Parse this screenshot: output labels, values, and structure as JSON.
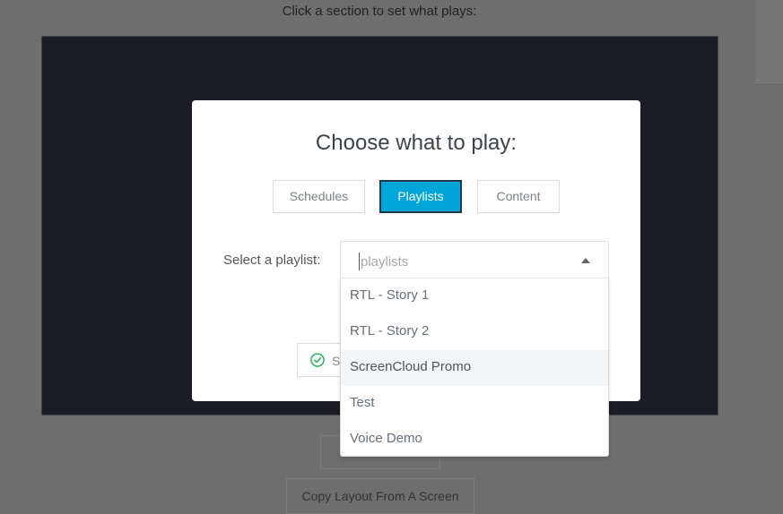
{
  "background": {
    "hint": "Click a section to set what plays:",
    "button_1_label": "",
    "button_2_label": "Copy Layout From A Screen"
  },
  "modal": {
    "title": "Choose what to play:",
    "tabs": [
      {
        "label": "Schedules",
        "active": false
      },
      {
        "label": "Playlists",
        "active": true
      },
      {
        "label": "Content",
        "active": false
      }
    ],
    "select_label": "Select a playlist:",
    "select_placeholder": "playlists",
    "save_label": "Save",
    "options": [
      "RTL - Story 1",
      "RTL - Story 2",
      "ScreenCloud Promo",
      "Test",
      "Voice Demo"
    ],
    "highlighted_option": "ScreenCloud Promo"
  },
  "colors": {
    "accent": "#00a6d9",
    "overlay": "#6e6e6e",
    "success": "#2eb35a"
  },
  "icons": {
    "save": "check-circle-icon",
    "dropdown": "caret-up-icon"
  }
}
